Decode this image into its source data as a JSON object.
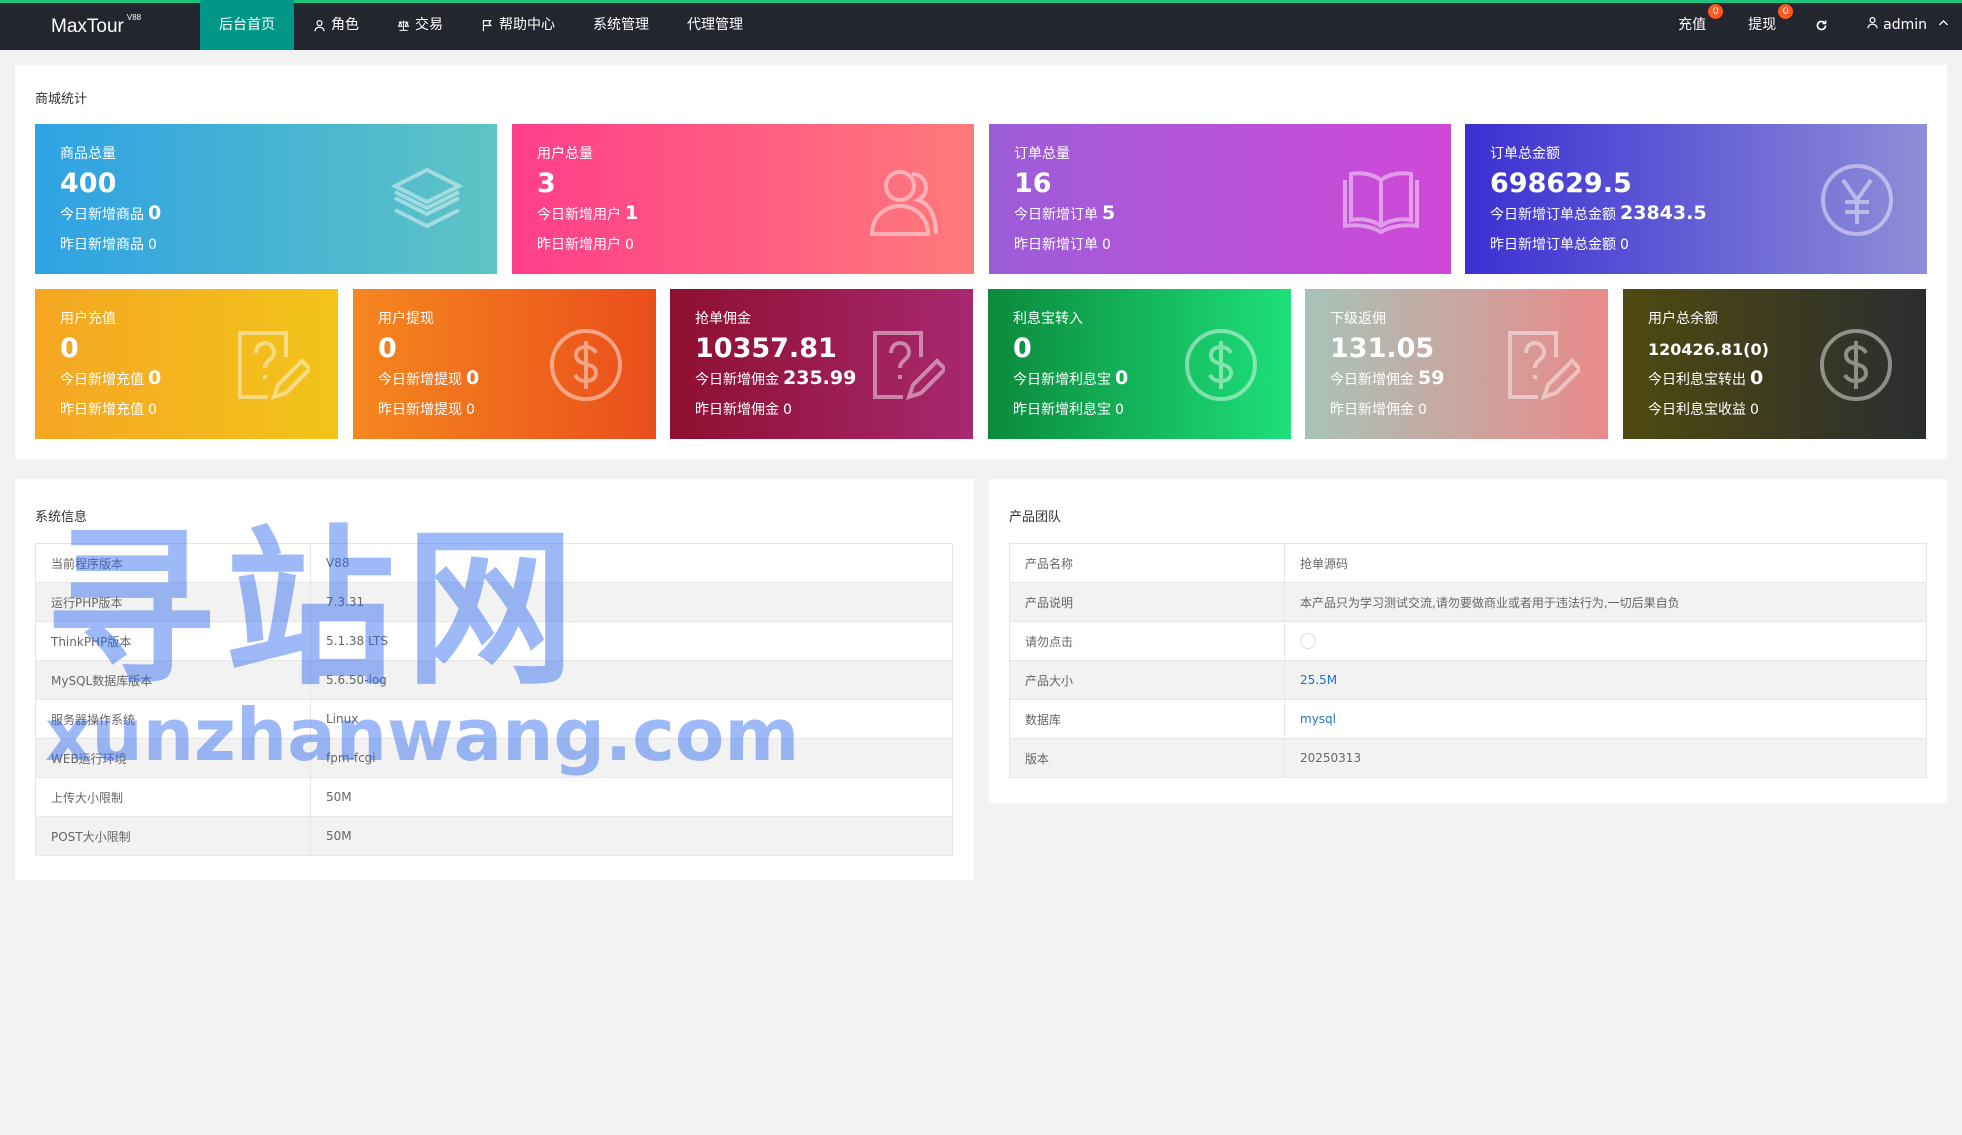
{
  "header": {
    "brand": "MaxTour",
    "version": "V88",
    "nav": [
      {
        "label": "后台首页",
        "icon": "",
        "active": true
      },
      {
        "label": "角色",
        "icon": "user-icon"
      },
      {
        "label": "交易",
        "icon": "scale-icon"
      },
      {
        "label": "帮助中心",
        "icon": "flag-icon"
      },
      {
        "label": "系统管理",
        "icon": ""
      },
      {
        "label": "代理管理",
        "icon": ""
      }
    ],
    "recharge_label": "充值",
    "recharge_badge": "0",
    "withdraw_label": "提现",
    "withdraw_badge": "0",
    "refresh_icon": "refresh-icon",
    "user_label": "admin"
  },
  "stats_card": {
    "title": "商城统计",
    "row1": [
      {
        "label": "商品总量",
        "value": "400",
        "today_label": "今日新增商品",
        "today_value": "0",
        "yesterday_label": "昨日新增商品",
        "yesterday_value": "0",
        "icon": "layers-icon",
        "gradient": [
          "#2ea2e4",
          "#5ec4c4"
        ]
      },
      {
        "label": "用户总量",
        "value": "3",
        "today_label": "今日新增用户",
        "today_value": "1",
        "yesterday_label": "昨日新增用户",
        "yesterday_value": "0",
        "icon": "users-icon",
        "gradient": [
          "#ff3e8a",
          "#ff7a7a"
        ]
      },
      {
        "label": "订单总量",
        "value": "16",
        "today_label": "今日新增订单",
        "today_value": "5",
        "yesterday_label": "昨日新增订单",
        "yesterday_value": "0",
        "icon": "book-icon",
        "gradient": [
          "#9c5dd8",
          "#d048d8"
        ]
      },
      {
        "label": "订单总金额",
        "value": "698629.5",
        "today_label": "今日新增订单总金额",
        "today_value": "23843.5",
        "yesterday_label": "昨日新增订单总金额",
        "yesterday_value": "0",
        "icon": "yen-icon",
        "gradient": [
          "#3b2fd2",
          "#8e8ed8"
        ]
      }
    ],
    "row2": [
      {
        "label": "用户充值",
        "value": "0",
        "today_label": "今日新增充值",
        "today_value": "0",
        "yesterday_label": "昨日新增充值",
        "yesterday_value": "0",
        "icon": "question-doc-icon",
        "gradient": [
          "#f5a623",
          "#f2c41a"
        ]
      },
      {
        "label": "用户提现",
        "value": "0",
        "today_label": "今日新增提现",
        "today_value": "0",
        "yesterday_label": "昨日新增提现",
        "yesterday_value": "0",
        "icon": "dollar-icon",
        "gradient": [
          "#f5871f",
          "#ea4e1b"
        ]
      },
      {
        "label": "抢单佣金",
        "value": "10357.81",
        "today_label": "今日新增佣金",
        "today_value": "235.99",
        "yesterday_label": "昨日新增佣金",
        "yesterday_value": "0",
        "icon": "question-doc-icon",
        "gradient": [
          "#8e0f2f",
          "#a82870"
        ]
      },
      {
        "label": "利息宝转入",
        "value": "0",
        "today_label": "今日新增利息宝",
        "today_value": "0",
        "yesterday_label": "昨日新增利息宝",
        "yesterday_value": "0",
        "icon": "dollar-icon",
        "gradient": [
          "#0b8a3c",
          "#1ee07a"
        ]
      },
      {
        "label": "下级返佣",
        "value": "131.05",
        "today_label": "今日新增佣金",
        "today_value": "59",
        "yesterday_label": "昨日新增佣金",
        "yesterday_value": "0",
        "icon": "question-doc-icon",
        "gradient": [
          "#a8c3b8",
          "#e98a8a"
        ]
      },
      {
        "label": "用户总余额",
        "value": "120426.81(0)",
        "today_label": "今日利息宝转出",
        "today_value": "0",
        "yesterday_label": "今日利息宝收益",
        "yesterday_value": "0",
        "icon": "dollar-icon",
        "gradient": [
          "#4f4a10",
          "#2a2d30"
        ]
      }
    ]
  },
  "system_info": {
    "title": "系统信息",
    "rows": [
      {
        "key": "当前程序版本",
        "value": "V88"
      },
      {
        "key": "运行PHP版本",
        "value": "7.3.31"
      },
      {
        "key": "ThinkPHP版本",
        "value": "5.1.38 LTS"
      },
      {
        "key": "MySQL数据库版本",
        "value": "5.6.50-log"
      },
      {
        "key": "服务器操作系统",
        "value": "Linux"
      },
      {
        "key": "WEB运行环境",
        "value": "fpm-fcgi"
      },
      {
        "key": "上传大小限制",
        "value": "50M"
      },
      {
        "key": "POST大小限制",
        "value": "50M"
      }
    ]
  },
  "product_team": {
    "title": "产品团队",
    "rows": [
      {
        "key": "产品名称",
        "value": "抢单源码"
      },
      {
        "key": "产品说明",
        "value": "本产品只为学习测试交流,请勿要做商业或者用于违法行为,一切后果自负"
      },
      {
        "key": "请勿点击",
        "value": ""
      },
      {
        "key": "产品大小",
        "value": "25.5M",
        "link": true
      },
      {
        "key": "数据库",
        "value": "mysql",
        "link": true
      },
      {
        "key": "版本",
        "value": "20250313"
      }
    ]
  },
  "watermark": {
    "text": "寻站网",
    "domain": "xunzhanwang.com"
  }
}
